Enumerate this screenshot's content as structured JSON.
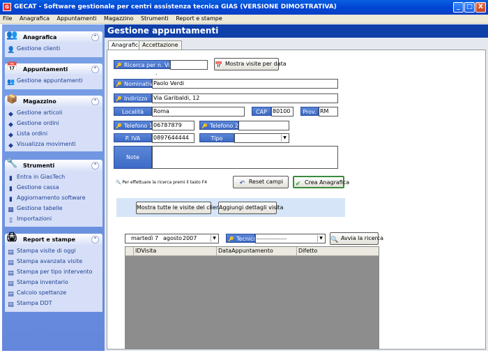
{
  "window": {
    "title": "GECAT - Software gestionale per centri assistenza tecnica GIAS  (VERSIONE DIMOSTRATIVA)",
    "controls": [
      "_",
      "□",
      "X"
    ]
  },
  "menu": [
    "File",
    "Anagrafica",
    "Appuntamenti",
    "Magazzino",
    "Strumenti",
    "Report e stampe"
  ],
  "sidebar": {
    "sections": [
      {
        "title": "Anagrafica",
        "items": [
          "Gestione clienti"
        ]
      },
      {
        "title": "Appuntamenti",
        "items": [
          "Gestione appuntamenti"
        ]
      },
      {
        "title": "Magazzino",
        "items": [
          "Gestione articoli",
          "Gestione ordini",
          "Lista ordini",
          "Visualizza movimenti"
        ]
      },
      {
        "title": "Strumenti",
        "items": [
          "Entra in GiasTech",
          "Gestione cassa",
          "Aggiornamento software",
          "Gestione tabelle",
          "Importazioni"
        ]
      },
      {
        "title": "Report e stampe",
        "items": [
          "Stampa visite di oggi",
          "Stampa avanzata visite",
          "Stampa per tipo intervento",
          "Stampa inventario",
          "Calcolo spettanze",
          "Stampa DDT"
        ]
      }
    ]
  },
  "main": {
    "title": "Gestione appuntamenti",
    "tabs": [
      "Anagrafica",
      "Accettazione"
    ]
  },
  "form": {
    "ricerca_label": "Ricerca per n. Visita",
    "ricerca_value": "",
    "mostra_visite_btn": "Mostra visite per data",
    "dot": ".",
    "nominativo_label": "Nominativo",
    "nominativo_value": "Paolo Verdi",
    "indirizzo_label": "Indirizzo",
    "indirizzo_value": "Via Garibaldi, 12",
    "localita_label": "Località",
    "localita_value": "Roma",
    "cap_label": "CAP",
    "cap_value": "80100",
    "prov_label": "Prov.",
    "prov_value": "RM",
    "tel1_label": "Telefono 1",
    "tel1_value": "06787879",
    "tel2_label": "Telefono 2",
    "tel2_value": "",
    "piva_label": "P. IVA",
    "piva_value": "0897644444",
    "tipo_label": "Tipo",
    "tipo_value": "",
    "note_label": "Note",
    "note_value": "",
    "hint": "Per effettuare la ricerca premi il tasto F4",
    "reset_btn": "Reset campi",
    "crea_btn": "Crea Anagrafica",
    "mostra_tutte_btn": "Mostra tutte le visite del cliente",
    "aggiungi_btn": "Aggiungi dettagli visita"
  },
  "filter": {
    "date_weekday": "martedì",
    "date_day": "7",
    "date_month": "agosto",
    "date_year": "2007",
    "tecnico_label": "Tecnico",
    "tecnico_value": "--------------------",
    "avvia_btn": "Avvia la ricerca"
  },
  "grid": {
    "columns": [
      "IDVisita",
      "DataAppuntamento",
      "Difetto"
    ]
  }
}
